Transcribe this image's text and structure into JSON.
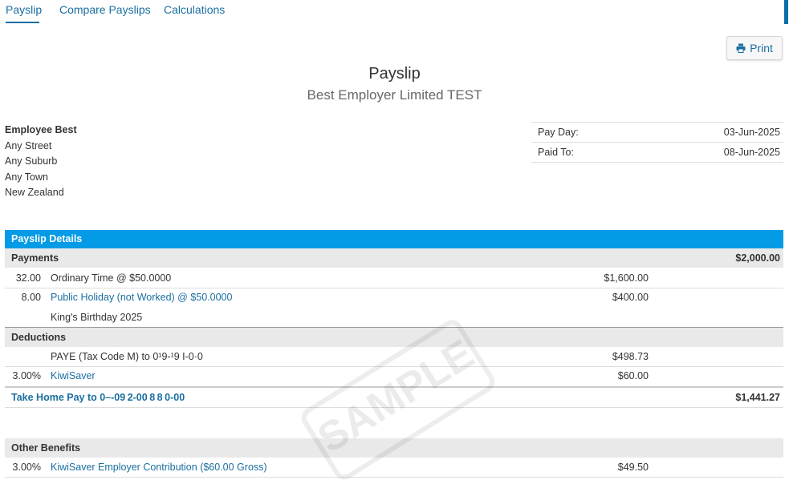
{
  "tabs": [
    {
      "label": "Payslip"
    },
    {
      "label": "Compare Payslips"
    },
    {
      "label": "Calculations"
    }
  ],
  "print_label": "Print",
  "header": {
    "title": "Payslip",
    "employer": "Best Employer Limited TEST"
  },
  "employee": {
    "name": "Employee Best",
    "street": "Any Street",
    "suburb": "Any Suburb",
    "town": "Any Town",
    "country": "New Zealand"
  },
  "pay_info": {
    "pay_day_label": "Pay Day:",
    "pay_day": "03-Jun-2025",
    "paid_to_label": "Paid To:",
    "paid_to": "08-Jun-2025"
  },
  "details": {
    "section_title": "Payslip Details",
    "payments": {
      "label": "Payments",
      "total": "$2,000.00",
      "rows": [
        {
          "qty": "32.00",
          "desc": "Ordinary Time @ $50.0000",
          "amount": "$1,600.00"
        },
        {
          "qty": "8.00",
          "desc": "Public Holiday (not Worked) @ $50.0000",
          "amount": "$400.00"
        }
      ],
      "note": "King's Birthday 2025"
    },
    "deductions": {
      "label": "Deductions",
      "rows": [
        {
          "qty": "",
          "desc": "PAYE (Tax Code M) to 0¹9-¹9 I-0·0",
          "amount": "$498.73"
        },
        {
          "qty": "3.00%",
          "desc": "KiwiSaver",
          "amount": "$60.00"
        }
      ]
    },
    "take_home": {
      "label": "Take Home Pay to 0–-09 2-00 8 8 0-00",
      "total": "$1,441.27"
    },
    "other_benefits": {
      "label": "Other Benefits",
      "rows": [
        {
          "qty": "3.00%",
          "desc": "KiwiSaver Employer Contribution ($60.00 Gross)",
          "amount": "$49.50"
        }
      ]
    }
  },
  "watermark": "SAMPLE",
  "colors": {
    "accent": "#039be5",
    "link": "#1a6ea0"
  }
}
